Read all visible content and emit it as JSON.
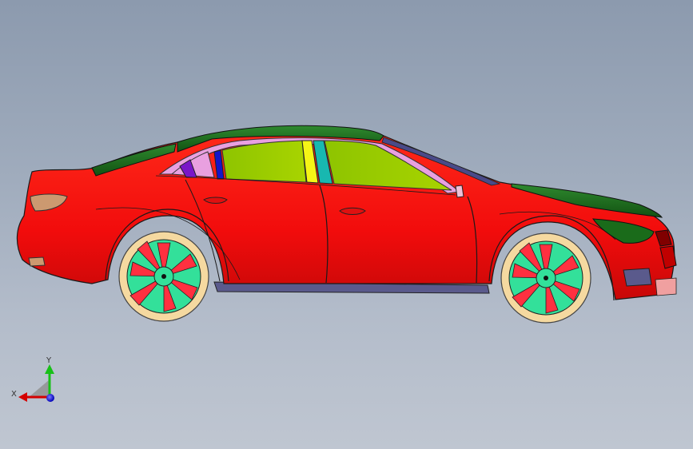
{
  "viewport": {
    "background_top": "#8c9aae",
    "background_bottom": "#bfc6d1"
  },
  "model": {
    "body_color": "#ff1010",
    "glass_color": "#99cc00",
    "roof_color": "#1e6b1e",
    "wheel_color": "#33e09a",
    "tire_color": "#f5d9a0",
    "rocker_color": "#5a5a8c"
  },
  "triad": {
    "x_label": "X",
    "y_label": "Y",
    "x_color": "#d40000",
    "y_color": "#18c018",
    "z_color": "#1a1ae0"
  }
}
